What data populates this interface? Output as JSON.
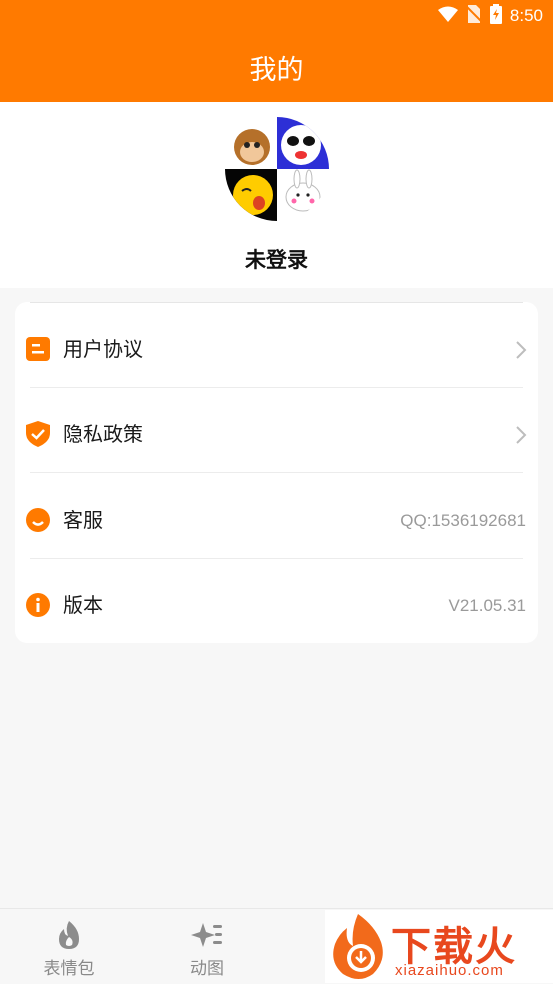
{
  "status_bar": {
    "time": "8:50",
    "icons": [
      "wifi-icon",
      "no-sim-icon",
      "battery-charging-icon"
    ]
  },
  "header": {
    "title": "我的"
  },
  "profile": {
    "name": "未登录",
    "avatar_icon": "emoji-collage-avatar"
  },
  "menu": {
    "items": [
      {
        "label": "用户协议",
        "icon": "document-icon",
        "value": "",
        "has_chevron": true
      },
      {
        "label": "隐私政策",
        "icon": "shield-check-icon",
        "value": "",
        "has_chevron": true
      },
      {
        "label": "客服",
        "icon": "smile-icon",
        "value": "QQ:1536192681",
        "has_chevron": false
      },
      {
        "label": "版本",
        "icon": "info-icon",
        "value": "V21.05.31",
        "has_chevron": false
      }
    ]
  },
  "tabbar": {
    "tabs": [
      {
        "label": "表情包",
        "icon": "flame-icon"
      },
      {
        "label": "动图",
        "icon": "sparkle-icon"
      }
    ]
  },
  "watermark": {
    "brand": "下载火",
    "url": "xiazaihuo.com"
  },
  "colors": {
    "accent": "#ff7a00",
    "background": "#f7f7f7",
    "card": "#ffffff",
    "muted_text": "#9a9a9a"
  }
}
